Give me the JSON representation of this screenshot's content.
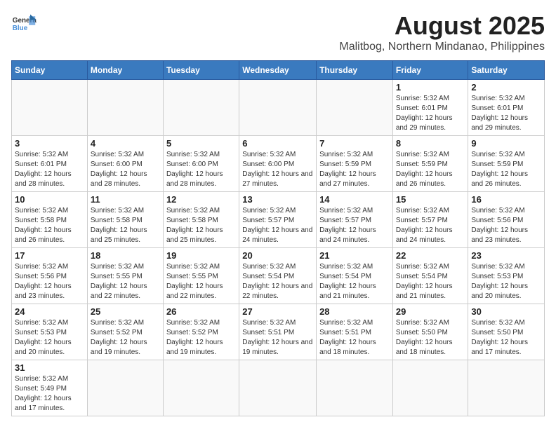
{
  "header": {
    "logo_general": "General",
    "logo_blue": "Blue",
    "title": "August 2025",
    "subtitle": "Malitbog, Northern Mindanao, Philippines"
  },
  "weekdays": [
    "Sunday",
    "Monday",
    "Tuesday",
    "Wednesday",
    "Thursday",
    "Friday",
    "Saturday"
  ],
  "weeks": [
    [
      {
        "day": "",
        "info": ""
      },
      {
        "day": "",
        "info": ""
      },
      {
        "day": "",
        "info": ""
      },
      {
        "day": "",
        "info": ""
      },
      {
        "day": "",
        "info": ""
      },
      {
        "day": "1",
        "info": "Sunrise: 5:32 AM\nSunset: 6:01 PM\nDaylight: 12 hours and 29 minutes."
      },
      {
        "day": "2",
        "info": "Sunrise: 5:32 AM\nSunset: 6:01 PM\nDaylight: 12 hours and 29 minutes."
      }
    ],
    [
      {
        "day": "3",
        "info": "Sunrise: 5:32 AM\nSunset: 6:01 PM\nDaylight: 12 hours and 28 minutes."
      },
      {
        "day": "4",
        "info": "Sunrise: 5:32 AM\nSunset: 6:00 PM\nDaylight: 12 hours and 28 minutes."
      },
      {
        "day": "5",
        "info": "Sunrise: 5:32 AM\nSunset: 6:00 PM\nDaylight: 12 hours and 28 minutes."
      },
      {
        "day": "6",
        "info": "Sunrise: 5:32 AM\nSunset: 6:00 PM\nDaylight: 12 hours and 27 minutes."
      },
      {
        "day": "7",
        "info": "Sunrise: 5:32 AM\nSunset: 5:59 PM\nDaylight: 12 hours and 27 minutes."
      },
      {
        "day": "8",
        "info": "Sunrise: 5:32 AM\nSunset: 5:59 PM\nDaylight: 12 hours and 26 minutes."
      },
      {
        "day": "9",
        "info": "Sunrise: 5:32 AM\nSunset: 5:59 PM\nDaylight: 12 hours and 26 minutes."
      }
    ],
    [
      {
        "day": "10",
        "info": "Sunrise: 5:32 AM\nSunset: 5:58 PM\nDaylight: 12 hours and 26 minutes."
      },
      {
        "day": "11",
        "info": "Sunrise: 5:32 AM\nSunset: 5:58 PM\nDaylight: 12 hours and 25 minutes."
      },
      {
        "day": "12",
        "info": "Sunrise: 5:32 AM\nSunset: 5:58 PM\nDaylight: 12 hours and 25 minutes."
      },
      {
        "day": "13",
        "info": "Sunrise: 5:32 AM\nSunset: 5:57 PM\nDaylight: 12 hours and 24 minutes."
      },
      {
        "day": "14",
        "info": "Sunrise: 5:32 AM\nSunset: 5:57 PM\nDaylight: 12 hours and 24 minutes."
      },
      {
        "day": "15",
        "info": "Sunrise: 5:32 AM\nSunset: 5:57 PM\nDaylight: 12 hours and 24 minutes."
      },
      {
        "day": "16",
        "info": "Sunrise: 5:32 AM\nSunset: 5:56 PM\nDaylight: 12 hours and 23 minutes."
      }
    ],
    [
      {
        "day": "17",
        "info": "Sunrise: 5:32 AM\nSunset: 5:56 PM\nDaylight: 12 hours and 23 minutes."
      },
      {
        "day": "18",
        "info": "Sunrise: 5:32 AM\nSunset: 5:55 PM\nDaylight: 12 hours and 22 minutes."
      },
      {
        "day": "19",
        "info": "Sunrise: 5:32 AM\nSunset: 5:55 PM\nDaylight: 12 hours and 22 minutes."
      },
      {
        "day": "20",
        "info": "Sunrise: 5:32 AM\nSunset: 5:54 PM\nDaylight: 12 hours and 22 minutes."
      },
      {
        "day": "21",
        "info": "Sunrise: 5:32 AM\nSunset: 5:54 PM\nDaylight: 12 hours and 21 minutes."
      },
      {
        "day": "22",
        "info": "Sunrise: 5:32 AM\nSunset: 5:54 PM\nDaylight: 12 hours and 21 minutes."
      },
      {
        "day": "23",
        "info": "Sunrise: 5:32 AM\nSunset: 5:53 PM\nDaylight: 12 hours and 20 minutes."
      }
    ],
    [
      {
        "day": "24",
        "info": "Sunrise: 5:32 AM\nSunset: 5:53 PM\nDaylight: 12 hours and 20 minutes."
      },
      {
        "day": "25",
        "info": "Sunrise: 5:32 AM\nSunset: 5:52 PM\nDaylight: 12 hours and 19 minutes."
      },
      {
        "day": "26",
        "info": "Sunrise: 5:32 AM\nSunset: 5:52 PM\nDaylight: 12 hours and 19 minutes."
      },
      {
        "day": "27",
        "info": "Sunrise: 5:32 AM\nSunset: 5:51 PM\nDaylight: 12 hours and 19 minutes."
      },
      {
        "day": "28",
        "info": "Sunrise: 5:32 AM\nSunset: 5:51 PM\nDaylight: 12 hours and 18 minutes."
      },
      {
        "day": "29",
        "info": "Sunrise: 5:32 AM\nSunset: 5:50 PM\nDaylight: 12 hours and 18 minutes."
      },
      {
        "day": "30",
        "info": "Sunrise: 5:32 AM\nSunset: 5:50 PM\nDaylight: 12 hours and 17 minutes."
      }
    ],
    [
      {
        "day": "31",
        "info": "Sunrise: 5:32 AM\nSunset: 5:49 PM\nDaylight: 12 hours and 17 minutes."
      },
      {
        "day": "",
        "info": ""
      },
      {
        "day": "",
        "info": ""
      },
      {
        "day": "",
        "info": ""
      },
      {
        "day": "",
        "info": ""
      },
      {
        "day": "",
        "info": ""
      },
      {
        "day": "",
        "info": ""
      }
    ]
  ]
}
